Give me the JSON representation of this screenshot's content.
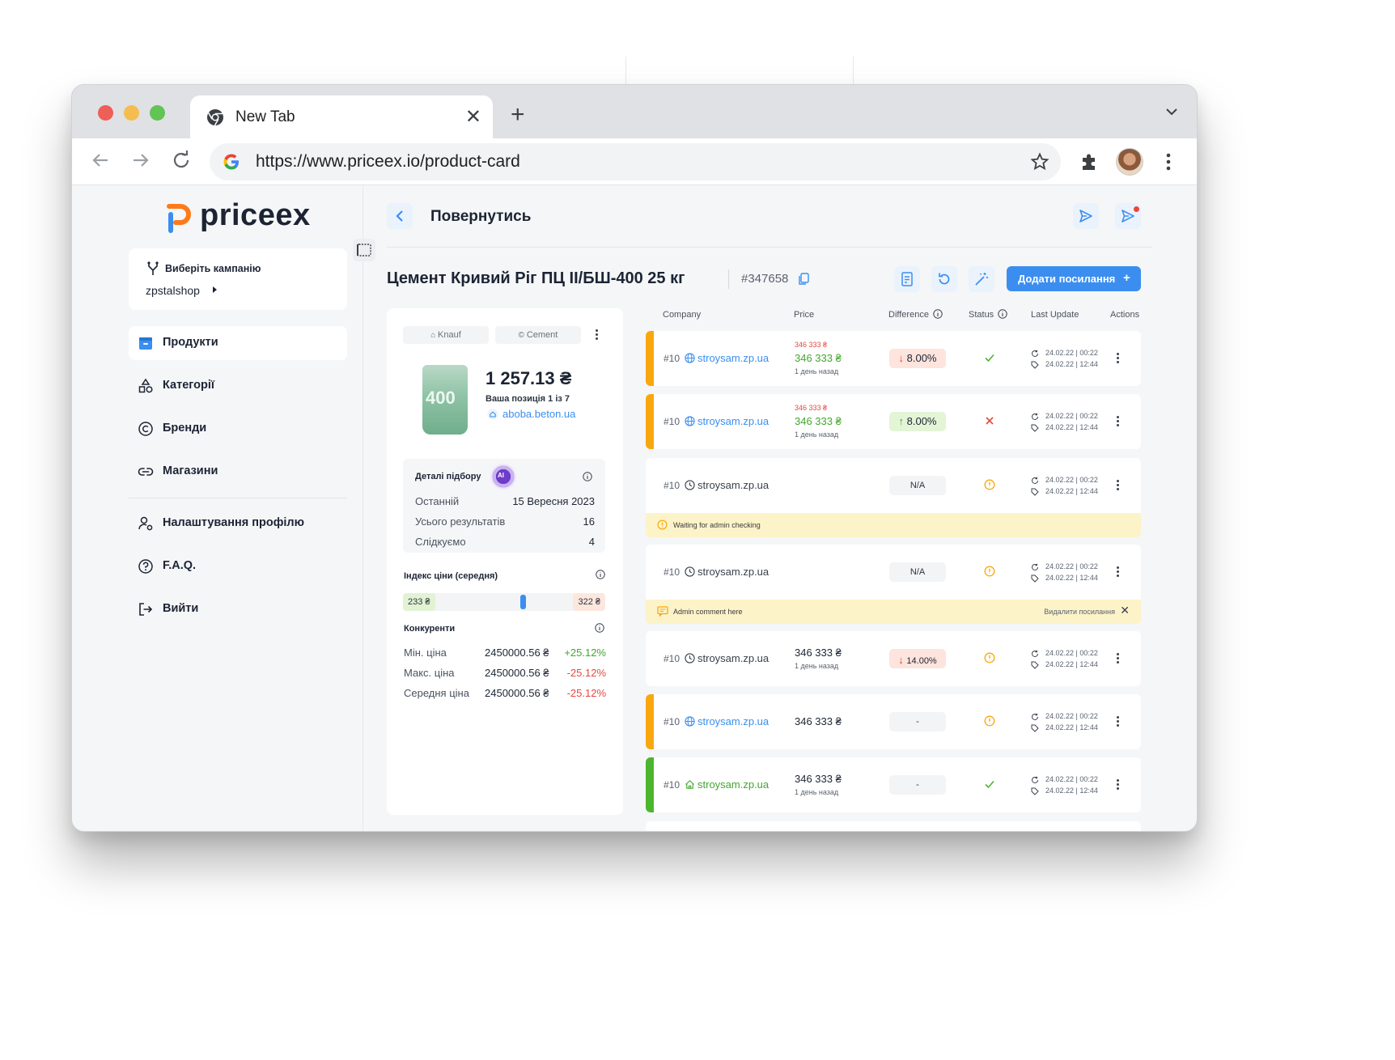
{
  "browser": {
    "tab_title": "New Tab",
    "url": "https://www.priceex.io/product-card",
    "colors": {
      "close": "#ee5f57",
      "minimize": "#f5bd4f",
      "maximize": "#61c454"
    }
  },
  "sidebar": {
    "logo": "priceex",
    "campaign_label": "Виберіть кампанію",
    "campaign_value": "zpstalshop",
    "items": [
      {
        "label": "Продукти",
        "icon": "box-icon"
      },
      {
        "label": "Категорії",
        "icon": "shapes-icon"
      },
      {
        "label": "Бренди",
        "icon": "copyright-icon"
      },
      {
        "label": "Магазини",
        "icon": "link-icon"
      },
      {
        "label": "Налаштування профілю",
        "icon": "user-settings-icon"
      },
      {
        "label": "F.A.Q.",
        "icon": "question-icon"
      },
      {
        "label": "Вийти",
        "icon": "logout-icon"
      }
    ]
  },
  "header": {
    "back_label": "Повернутись"
  },
  "product": {
    "title": "Цемент Кривий Ріг ПЦ ІІ/БШ-400 25 кг",
    "id": "#347658",
    "add_button": "Додати посилання",
    "chips": [
      "Knauf",
      "Cement"
    ],
    "bag_label": "400",
    "price": "1 257.13 ₴",
    "position": "Ваша позиція 1 із 7",
    "shop": "aboba.beton.ua",
    "details": {
      "title": "Деталі підбору",
      "ai": "AI",
      "rows": [
        {
          "label": "Останній",
          "value": "15 Вересня 2023"
        },
        {
          "label": "Усього результатів",
          "value": "16"
        },
        {
          "label": "Слідкуємо",
          "value": "4"
        }
      ]
    },
    "price_index": {
      "title": "Індекс ціни (середня)",
      "min": "233 ₴",
      "max": "322 ₴"
    },
    "competitors": {
      "title": "Конкуренти",
      "rows": [
        {
          "label": "Мін. ціна",
          "price": "2450000.56 ₴",
          "delta": "+25.12%",
          "color": "#43a62f"
        },
        {
          "label": "Макс. ціна",
          "price": "2450000.56 ₴",
          "delta": "-25.12%",
          "color": "#e5483d"
        },
        {
          "label": "Середня ціна",
          "price": "2450000.56 ₴",
          "delta": "-25.12%",
          "color": "#e5483d"
        }
      ]
    }
  },
  "table": {
    "headers": [
      "Company",
      "Price",
      "Difference",
      "Status",
      "Last Update",
      "Actions"
    ],
    "rows": [
      {
        "rank": "#10",
        "site": "stroysam.zp.ua",
        "old_price": "346 333 ₴",
        "price": "346 333 ₴",
        "ago": "1 день назад",
        "diff": "8.00%",
        "diff_dir": "down",
        "status": "check",
        "upd1": "24.02.22 | 00:22",
        "upd2": "24.02.22 | 12:44",
        "bar": "#f9a70f"
      },
      {
        "rank": "#10",
        "site": "stroysam.zp.ua",
        "old_price": "346 333 ₴",
        "price": "346 333 ₴",
        "ago": "1 день назад",
        "diff": "8.00%",
        "diff_dir": "up",
        "status": "cross",
        "upd1": "24.02.22 | 00:22",
        "upd2": "24.02.22 | 12:44",
        "bar": "#f9a70f"
      },
      {
        "rank": "#10",
        "site": "stroysam.zp.ua",
        "diff": "N/A",
        "status": "warn",
        "upd1": "24.02.22 | 00:22",
        "upd2": "24.02.22 | 12:44",
        "banner": "Waiting for admin checking"
      },
      {
        "rank": "#10",
        "site": "stroysam.zp.ua",
        "diff": "N/A",
        "status": "warn",
        "upd1": "24.02.22 | 00:22",
        "upd2": "24.02.22 | 12:44",
        "banner": "Admin comment here",
        "banner_action": "Видалити посилання"
      },
      {
        "rank": "#10",
        "site": "stroysam.zp.ua",
        "price": "346 333 ₴",
        "ago": "1 день назад",
        "diff": "14.00%",
        "diff_dir": "down",
        "status": "warn",
        "upd1": "24.02.22 | 00:22",
        "upd2": "24.02.22 | 12:44"
      },
      {
        "rank": "#10",
        "site": "stroysam.zp.ua",
        "price": "346 333 ₴",
        "diff": "-",
        "status": "warn",
        "upd1": "24.02.22 | 00:22",
        "upd2": "24.02.22 | 12:44",
        "bar": "#f9a70f"
      },
      {
        "rank": "#10",
        "site": "stroysam.zp.ua",
        "price": "346 333 ₴",
        "ago": "1 день назад",
        "diff": "-",
        "status": "check",
        "upd1": "24.02.22 | 00:22",
        "upd2": "24.02.22 | 12:44",
        "bar": "#4cb52e"
      }
    ]
  }
}
